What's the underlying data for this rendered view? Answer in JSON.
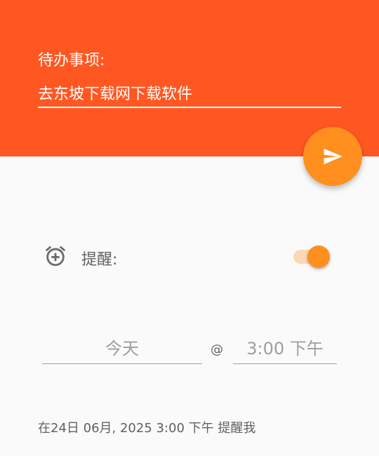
{
  "todo": {
    "label": "待办事项:",
    "value": "去东坡下载网下载软件"
  },
  "send_button": {
    "icon": "send-icon"
  },
  "reminder": {
    "icon": "alarm-add-icon",
    "label": "提醒:",
    "toggle_on": true
  },
  "schedule": {
    "date": "今天",
    "at": "@",
    "time": "3:00 下午"
  },
  "summary": "在24日 06月, 2025 3:00 下午 提醒我",
  "colors": {
    "header": "#ff5722",
    "accent": "#ff8f1e",
    "toggle_track": "#fcd9b4",
    "background": "#fafafa"
  }
}
